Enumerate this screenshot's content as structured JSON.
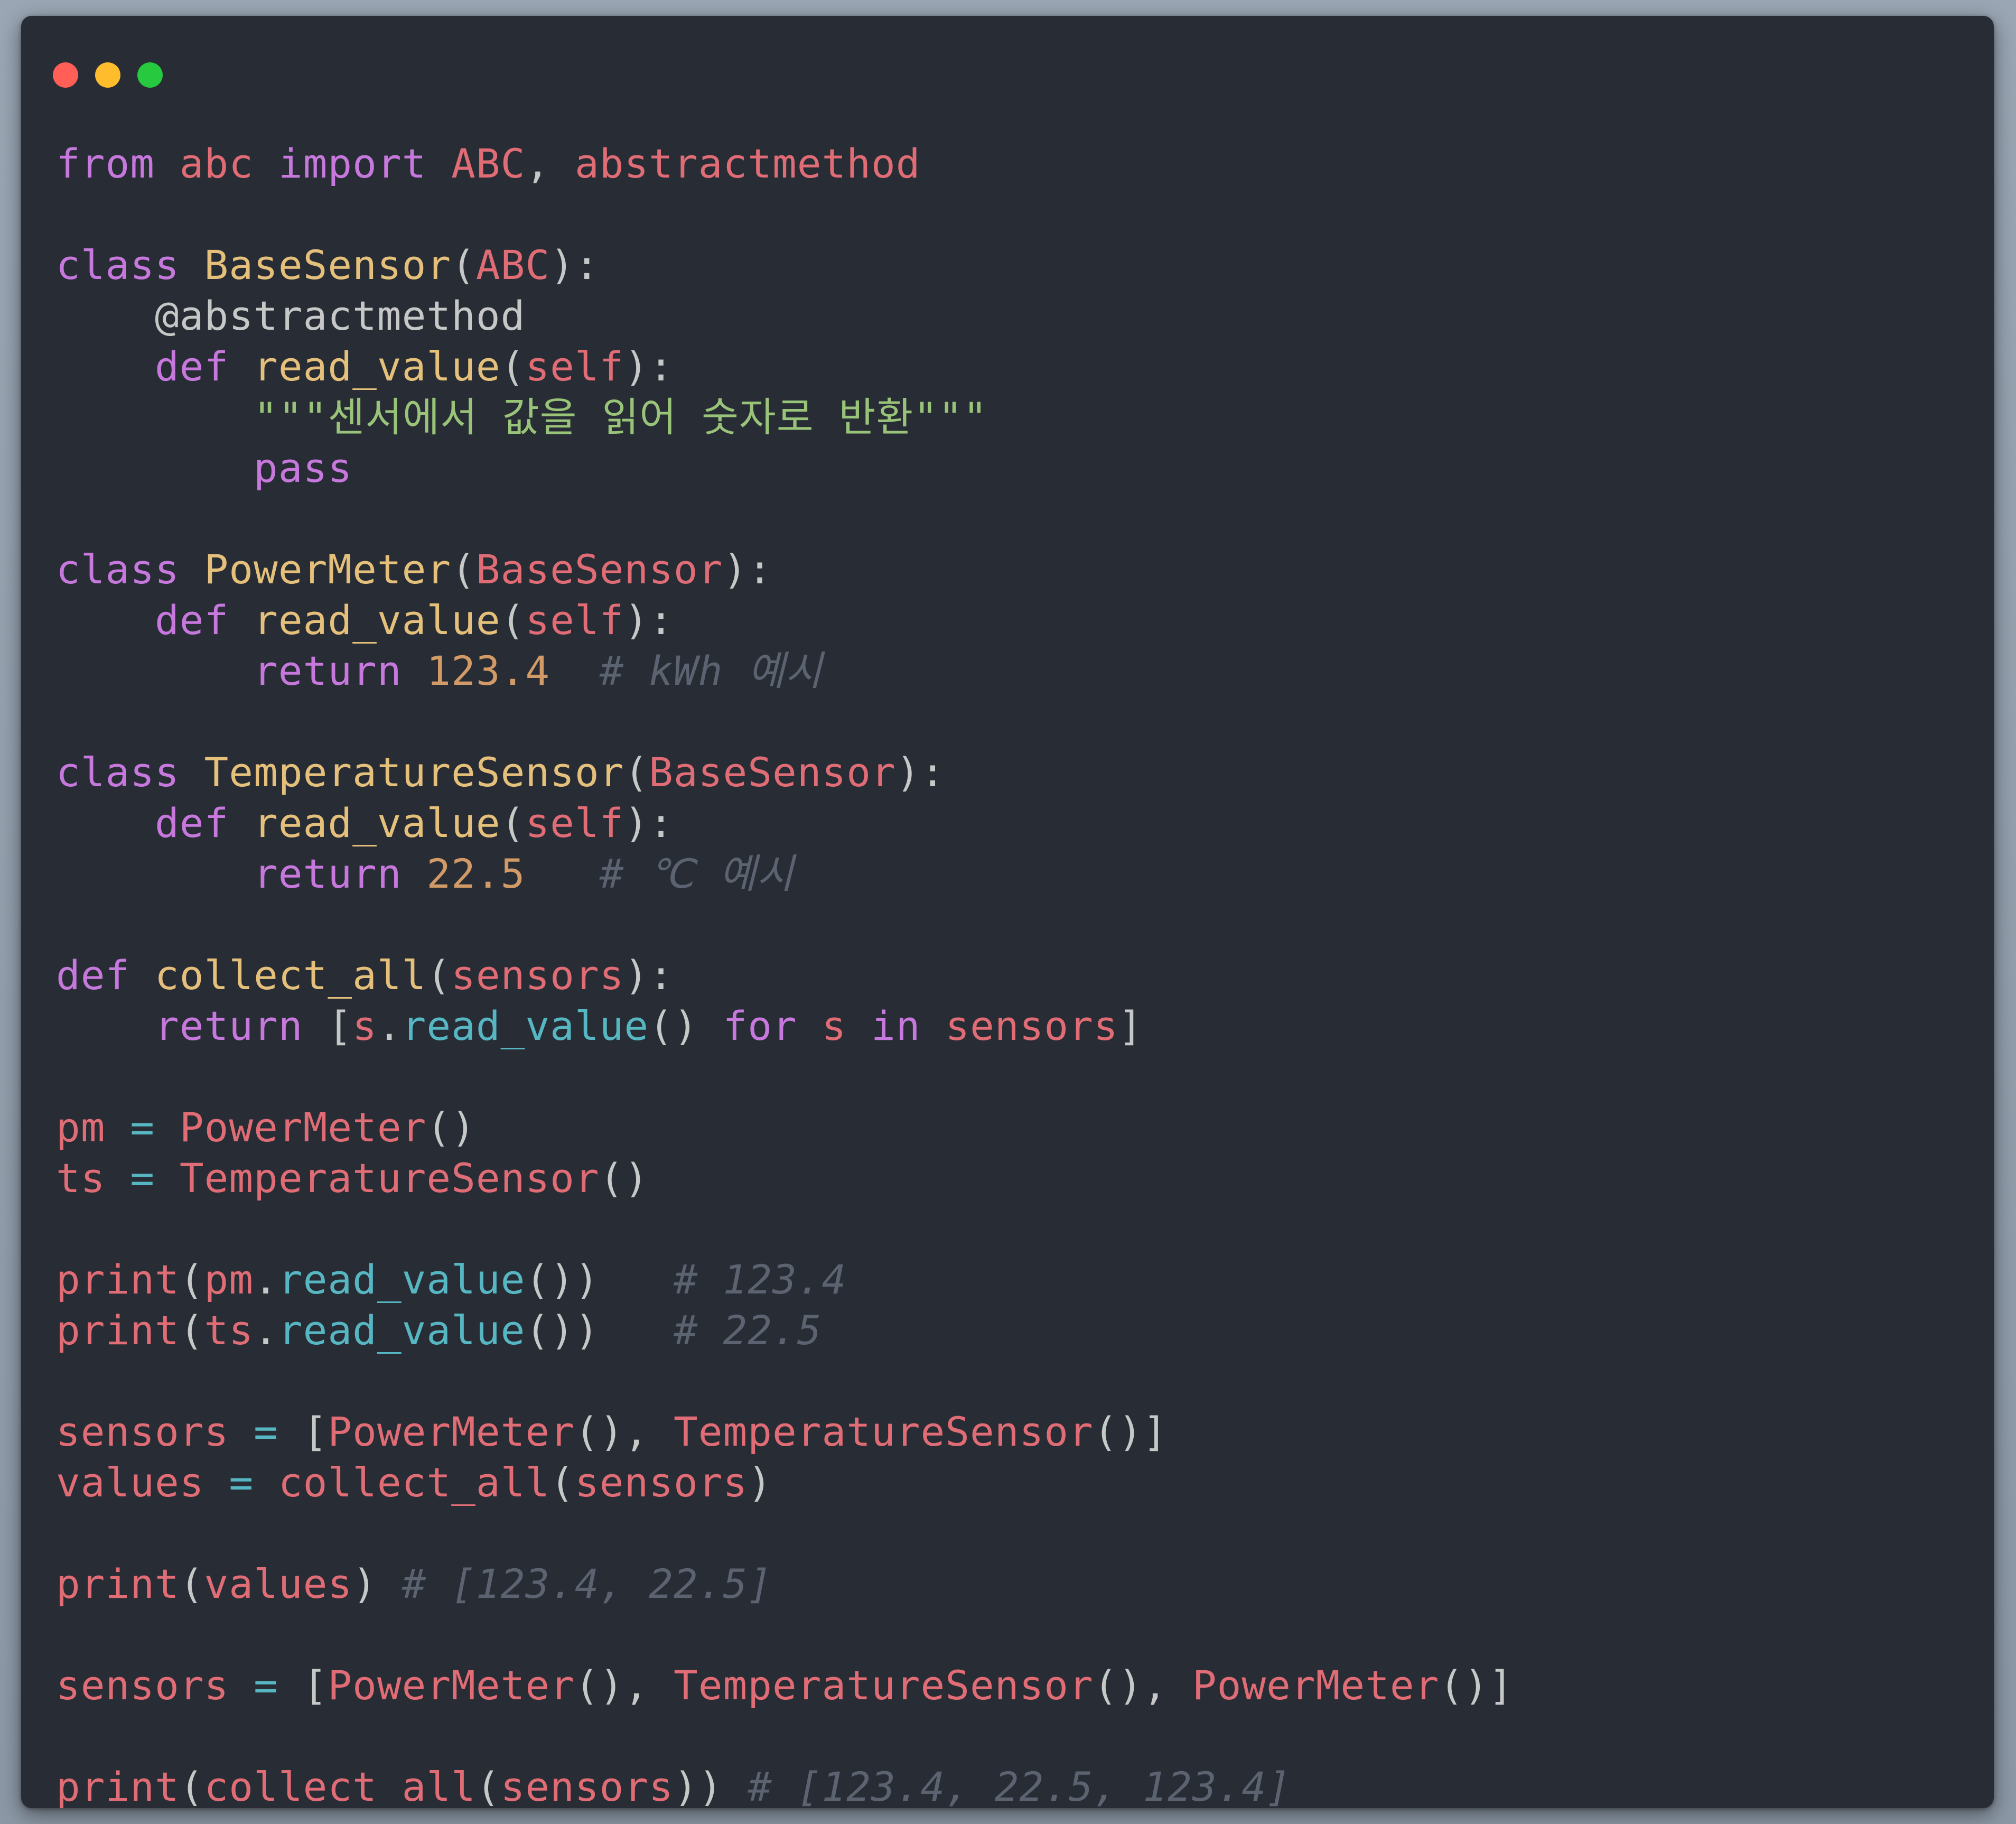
{
  "window": {
    "controls": [
      "close",
      "minimize",
      "zoom"
    ]
  },
  "code": {
    "language": "python",
    "lines": [
      [
        {
          "t": "kw",
          "v": "from"
        },
        {
          "t": "pn",
          "v": " "
        },
        {
          "t": "id",
          "v": "abc"
        },
        {
          "t": "pn",
          "v": " "
        },
        {
          "t": "kw",
          "v": "import"
        },
        {
          "t": "pn",
          "v": " "
        },
        {
          "t": "id",
          "v": "ABC"
        },
        {
          "t": "pn",
          "v": ", "
        },
        {
          "t": "id",
          "v": "abstractmethod"
        }
      ],
      [],
      [
        {
          "t": "kw",
          "v": "class"
        },
        {
          "t": "pn",
          "v": " "
        },
        {
          "t": "cls",
          "v": "BaseSensor"
        },
        {
          "t": "pn",
          "v": "("
        },
        {
          "t": "id",
          "v": "ABC"
        },
        {
          "t": "pn",
          "v": "):"
        }
      ],
      [
        {
          "t": "pn",
          "v": "    "
        },
        {
          "t": "dec",
          "v": "@abstractmethod"
        }
      ],
      [
        {
          "t": "pn",
          "v": "    "
        },
        {
          "t": "kw",
          "v": "def"
        },
        {
          "t": "pn",
          "v": " "
        },
        {
          "t": "fn",
          "v": "read_value"
        },
        {
          "t": "pn",
          "v": "("
        },
        {
          "t": "id",
          "v": "self"
        },
        {
          "t": "pn",
          "v": "):"
        }
      ],
      [
        {
          "t": "pn",
          "v": "        "
        },
        {
          "t": "str",
          "v": "\"\"\"센서에서 값을 읽어 숫자로 반환\"\"\""
        }
      ],
      [
        {
          "t": "pn",
          "v": "        "
        },
        {
          "t": "kw",
          "v": "pass"
        }
      ],
      [],
      [
        {
          "t": "kw",
          "v": "class"
        },
        {
          "t": "pn",
          "v": " "
        },
        {
          "t": "cls",
          "v": "PowerMeter"
        },
        {
          "t": "pn",
          "v": "("
        },
        {
          "t": "id",
          "v": "BaseSensor"
        },
        {
          "t": "pn",
          "v": "):"
        }
      ],
      [
        {
          "t": "pn",
          "v": "    "
        },
        {
          "t": "kw",
          "v": "def"
        },
        {
          "t": "pn",
          "v": " "
        },
        {
          "t": "fn",
          "v": "read_value"
        },
        {
          "t": "pn",
          "v": "("
        },
        {
          "t": "id",
          "v": "self"
        },
        {
          "t": "pn",
          "v": "):"
        }
      ],
      [
        {
          "t": "pn",
          "v": "        "
        },
        {
          "t": "kw",
          "v": "return"
        },
        {
          "t": "pn",
          "v": " "
        },
        {
          "t": "num",
          "v": "123.4"
        },
        {
          "t": "pn",
          "v": "  "
        },
        {
          "t": "cmt",
          "v": "# kWh 예시"
        }
      ],
      [],
      [
        {
          "t": "kw",
          "v": "class"
        },
        {
          "t": "pn",
          "v": " "
        },
        {
          "t": "cls",
          "v": "TemperatureSensor"
        },
        {
          "t": "pn",
          "v": "("
        },
        {
          "t": "id",
          "v": "BaseSensor"
        },
        {
          "t": "pn",
          "v": "):"
        }
      ],
      [
        {
          "t": "pn",
          "v": "    "
        },
        {
          "t": "kw",
          "v": "def"
        },
        {
          "t": "pn",
          "v": " "
        },
        {
          "t": "fn",
          "v": "read_value"
        },
        {
          "t": "pn",
          "v": "("
        },
        {
          "t": "id",
          "v": "self"
        },
        {
          "t": "pn",
          "v": "):"
        }
      ],
      [
        {
          "t": "pn",
          "v": "        "
        },
        {
          "t": "kw",
          "v": "return"
        },
        {
          "t": "pn",
          "v": " "
        },
        {
          "t": "num",
          "v": "22.5"
        },
        {
          "t": "pn",
          "v": "   "
        },
        {
          "t": "cmt",
          "v": "# ℃ 예시"
        }
      ],
      [],
      [
        {
          "t": "kw",
          "v": "def"
        },
        {
          "t": "pn",
          "v": " "
        },
        {
          "t": "fn",
          "v": "collect_all"
        },
        {
          "t": "pn",
          "v": "("
        },
        {
          "t": "id",
          "v": "sensors"
        },
        {
          "t": "pn",
          "v": "):"
        }
      ],
      [
        {
          "t": "pn",
          "v": "    "
        },
        {
          "t": "kw",
          "v": "return"
        },
        {
          "t": "pn",
          "v": " ["
        },
        {
          "t": "id",
          "v": "s"
        },
        {
          "t": "pn",
          "v": "."
        },
        {
          "t": "mth",
          "v": "read_value"
        },
        {
          "t": "pn",
          "v": "() "
        },
        {
          "t": "kw",
          "v": "for"
        },
        {
          "t": "pn",
          "v": " "
        },
        {
          "t": "id",
          "v": "s"
        },
        {
          "t": "pn",
          "v": " "
        },
        {
          "t": "kw",
          "v": "in"
        },
        {
          "t": "pn",
          "v": " "
        },
        {
          "t": "id",
          "v": "sensors"
        },
        {
          "t": "pn",
          "v": "]"
        }
      ],
      [],
      [
        {
          "t": "id",
          "v": "pm"
        },
        {
          "t": "pn",
          "v": " "
        },
        {
          "t": "mth",
          "v": "="
        },
        {
          "t": "pn",
          "v": " "
        },
        {
          "t": "id",
          "v": "PowerMeter"
        },
        {
          "t": "pn",
          "v": "()"
        }
      ],
      [
        {
          "t": "id",
          "v": "ts"
        },
        {
          "t": "pn",
          "v": " "
        },
        {
          "t": "mth",
          "v": "="
        },
        {
          "t": "pn",
          "v": " "
        },
        {
          "t": "id",
          "v": "TemperatureSensor"
        },
        {
          "t": "pn",
          "v": "()"
        }
      ],
      [],
      [
        {
          "t": "id",
          "v": "print"
        },
        {
          "t": "pn",
          "v": "("
        },
        {
          "t": "id",
          "v": "pm"
        },
        {
          "t": "pn",
          "v": "."
        },
        {
          "t": "mth",
          "v": "read_value"
        },
        {
          "t": "pn",
          "v": "())   "
        },
        {
          "t": "cmt",
          "v": "# 123.4"
        }
      ],
      [
        {
          "t": "id",
          "v": "print"
        },
        {
          "t": "pn",
          "v": "("
        },
        {
          "t": "id",
          "v": "ts"
        },
        {
          "t": "pn",
          "v": "."
        },
        {
          "t": "mth",
          "v": "read_value"
        },
        {
          "t": "pn",
          "v": "())   "
        },
        {
          "t": "cmt",
          "v": "# 22.5"
        }
      ],
      [],
      [
        {
          "t": "id",
          "v": "sensors"
        },
        {
          "t": "pn",
          "v": " "
        },
        {
          "t": "mth",
          "v": "="
        },
        {
          "t": "pn",
          "v": " ["
        },
        {
          "t": "id",
          "v": "PowerMeter"
        },
        {
          "t": "pn",
          "v": "(), "
        },
        {
          "t": "id",
          "v": "TemperatureSensor"
        },
        {
          "t": "pn",
          "v": "()]"
        }
      ],
      [
        {
          "t": "id",
          "v": "values"
        },
        {
          "t": "pn",
          "v": " "
        },
        {
          "t": "mth",
          "v": "="
        },
        {
          "t": "pn",
          "v": " "
        },
        {
          "t": "id",
          "v": "collect_all"
        },
        {
          "t": "pn",
          "v": "("
        },
        {
          "t": "id",
          "v": "sensors"
        },
        {
          "t": "pn",
          "v": ")"
        }
      ],
      [],
      [
        {
          "t": "id",
          "v": "print"
        },
        {
          "t": "pn",
          "v": "("
        },
        {
          "t": "id",
          "v": "values"
        },
        {
          "t": "pn",
          "v": ") "
        },
        {
          "t": "cmt",
          "v": "# [123.4, 22.5]"
        }
      ],
      [],
      [
        {
          "t": "id",
          "v": "sensors"
        },
        {
          "t": "pn",
          "v": " "
        },
        {
          "t": "mth",
          "v": "="
        },
        {
          "t": "pn",
          "v": " ["
        },
        {
          "t": "id",
          "v": "PowerMeter"
        },
        {
          "t": "pn",
          "v": "(), "
        },
        {
          "t": "id",
          "v": "TemperatureSensor"
        },
        {
          "t": "pn",
          "v": "(), "
        },
        {
          "t": "id",
          "v": "PowerMeter"
        },
        {
          "t": "pn",
          "v": "()]"
        }
      ],
      [],
      [
        {
          "t": "id",
          "v": "print"
        },
        {
          "t": "pn",
          "v": "("
        },
        {
          "t": "id",
          "v": "collect_all"
        },
        {
          "t": "pn",
          "v": "("
        },
        {
          "t": "id",
          "v": "sensors"
        },
        {
          "t": "pn",
          "v": ")) "
        },
        {
          "t": "cmt",
          "v": "# [123.4, 22.5, 123.4]"
        }
      ]
    ]
  },
  "colors": {
    "background": "#282c35",
    "keyword": "#c678dd",
    "identifier": "#e06c75",
    "class_name": "#e5c07b",
    "string": "#98c379",
    "number": "#d19a66",
    "comment": "#5c6370",
    "method": "#56b6c2"
  }
}
